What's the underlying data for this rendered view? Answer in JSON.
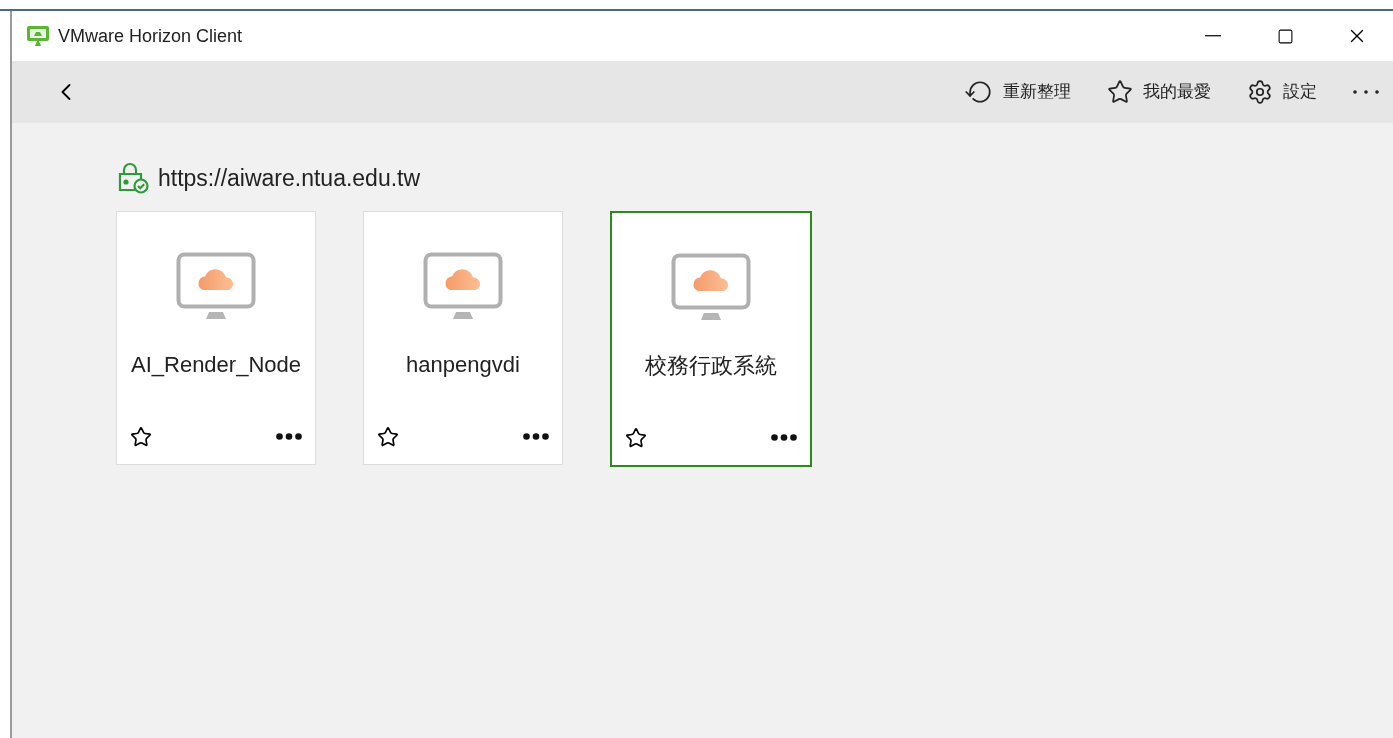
{
  "window": {
    "title": "VMware Horizon Client"
  },
  "toolbar": {
    "actions": [
      {
        "kind": "refresh",
        "label": "重新整理"
      },
      {
        "kind": "favorites",
        "label": "我的最愛"
      },
      {
        "kind": "settings",
        "label": "設定"
      }
    ]
  },
  "server": {
    "url": "https://aiware.ntua.edu.tw"
  },
  "desktops": [
    {
      "name": "AI_Render_Node",
      "selected": false,
      "favorite": false
    },
    {
      "name": "hanpengvdi",
      "selected": false,
      "favorite": false
    },
    {
      "name": "校務行政系統",
      "selected": true,
      "favorite": false
    }
  ]
}
